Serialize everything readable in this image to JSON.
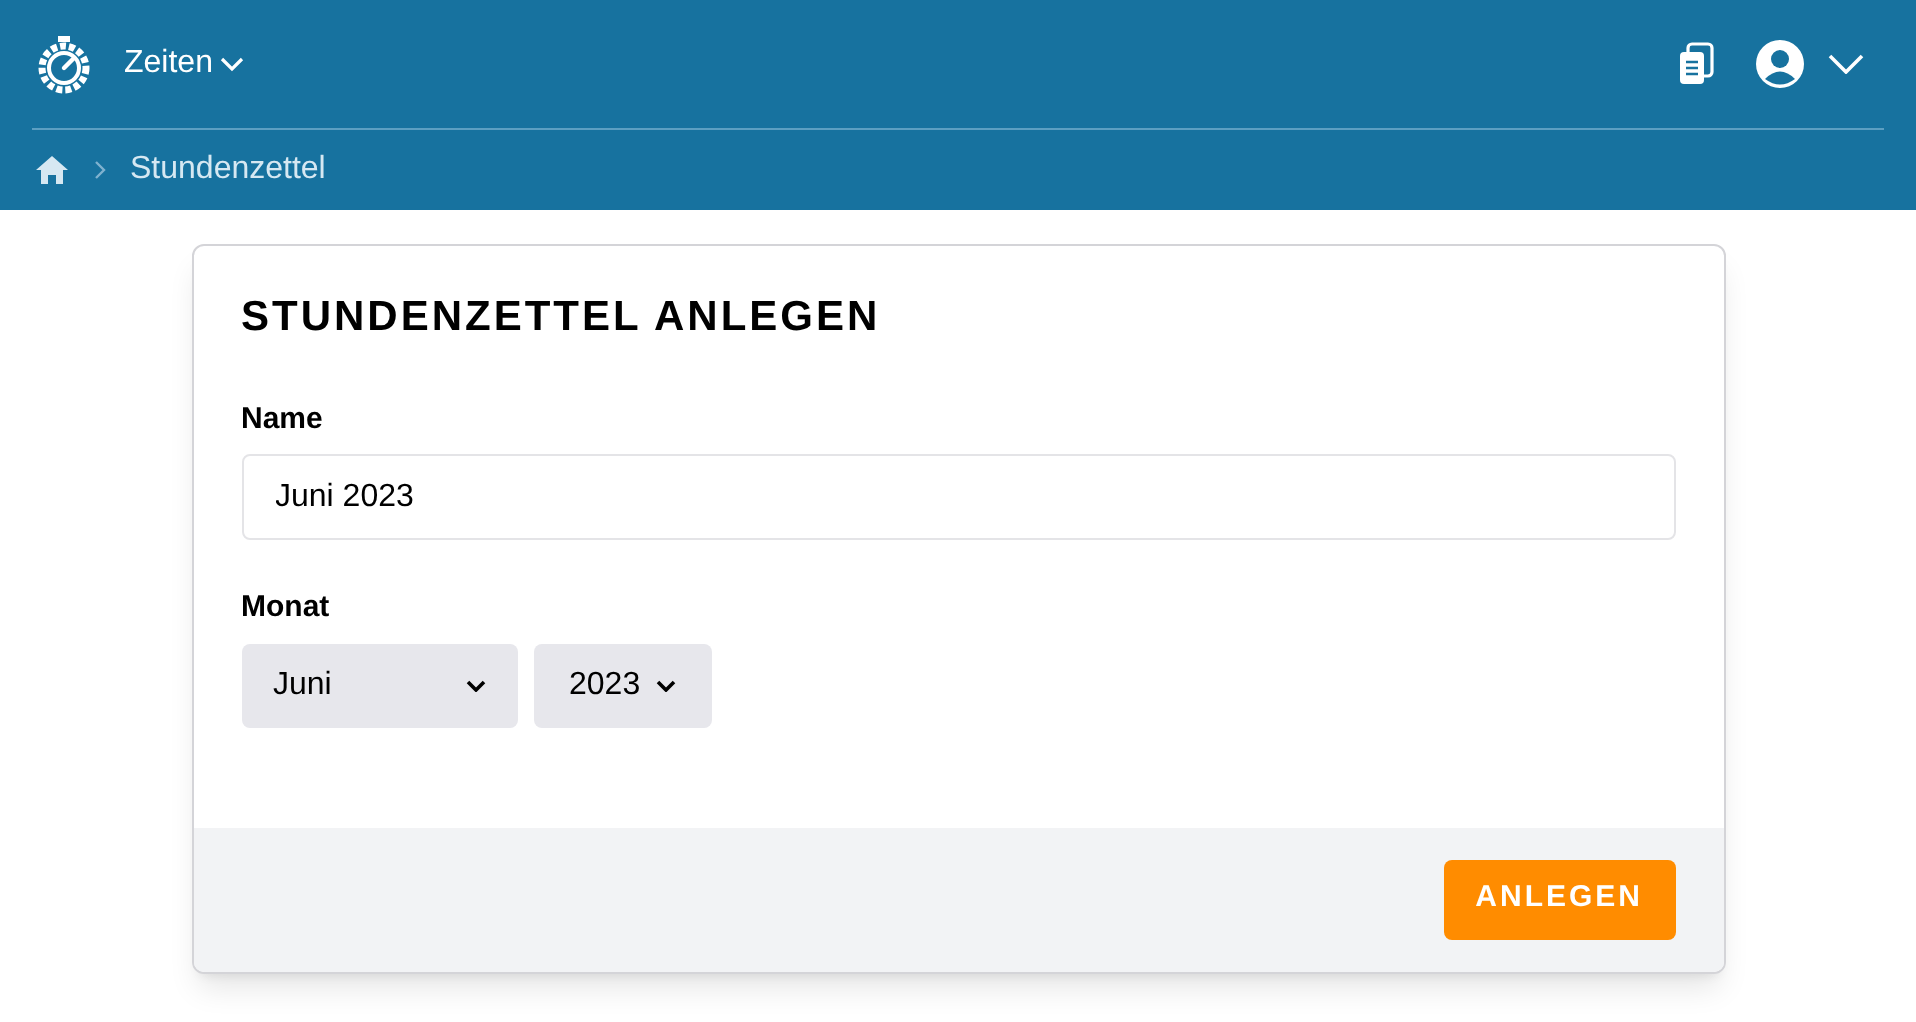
{
  "header": {
    "menu": {
      "label": "Zeiten"
    }
  },
  "breadcrumb": {
    "items": [
      {
        "label": "Stundenzettel"
      }
    ]
  },
  "form": {
    "title": "STUNDENZETTEL ANLEGEN",
    "name_field": {
      "label": "Name",
      "value": "Juni 2023"
    },
    "month": {
      "label": "Monat",
      "month_select": {
        "value": "Juni"
      },
      "year_select": {
        "value": "2023"
      }
    },
    "submit_button": {
      "label": "ANLEGEN"
    }
  }
}
